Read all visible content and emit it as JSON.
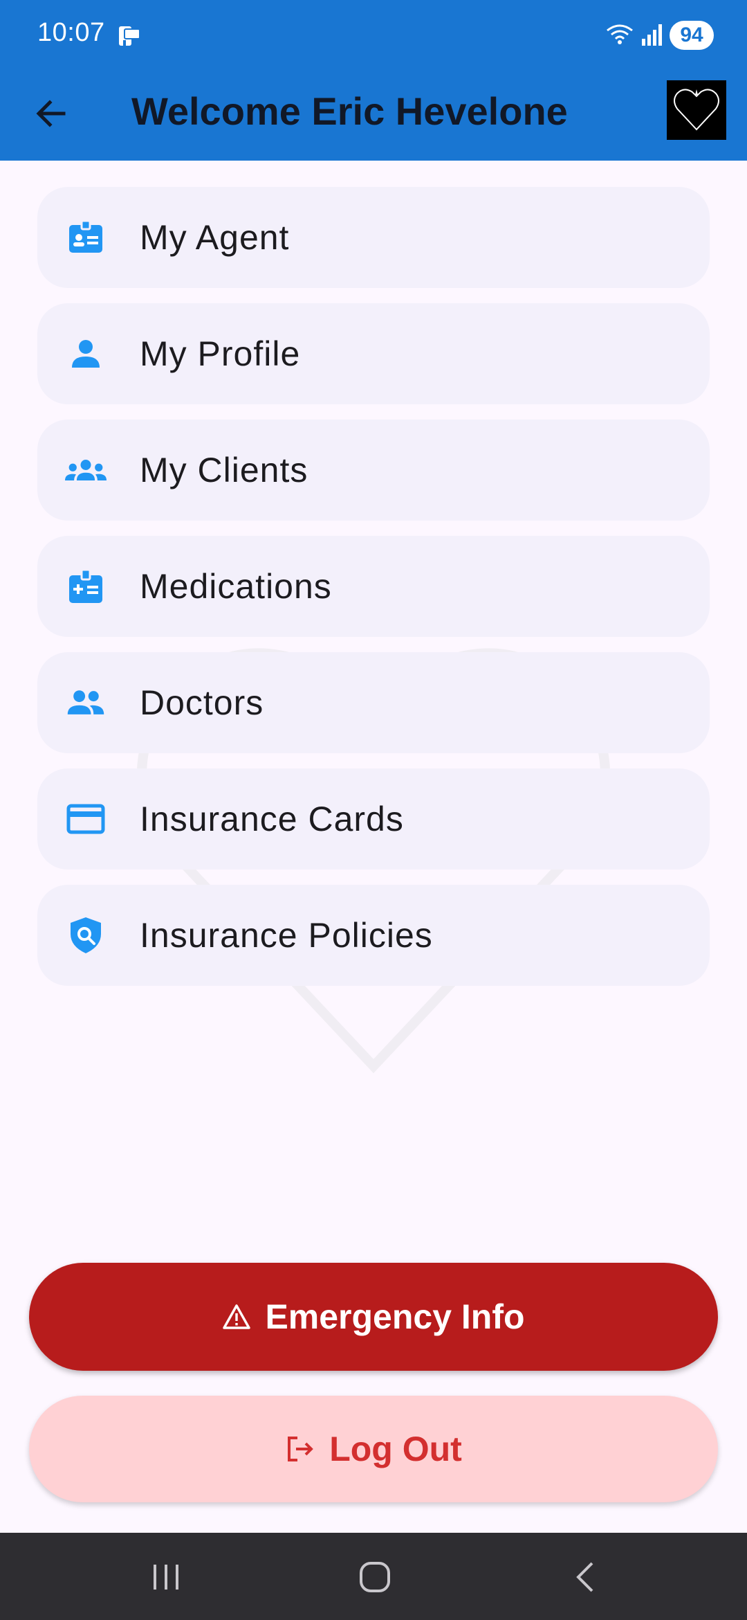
{
  "status_bar": {
    "time": "10:07",
    "battery": "94",
    "icons": [
      "notification-icon",
      "wifi-icon",
      "signal-icon"
    ]
  },
  "app_bar": {
    "title": "Welcome Eric Hevelone",
    "back_icon": "arrow-left-icon",
    "logo_icon": "heart-logo-icon",
    "background": "#1976d2"
  },
  "menu": {
    "items": [
      {
        "label": "My Agent",
        "icon": "badge-icon"
      },
      {
        "label": "My Profile",
        "icon": "person-icon"
      },
      {
        "label": "My Clients",
        "icon": "groups-icon"
      },
      {
        "label": "Medications",
        "icon": "medical-kit-icon"
      },
      {
        "label": "Doctors",
        "icon": "people-icon"
      },
      {
        "label": "Insurance Cards",
        "icon": "credit-card-icon"
      },
      {
        "label": "Insurance Policies",
        "icon": "shield-search-icon"
      }
    ],
    "icon_color": "#2196f3",
    "item_background": "#f3f0fb"
  },
  "actions": {
    "emergency_label": "Emergency Info",
    "emergency_icon": "warning-icon",
    "emergency_color": "#b71c1c",
    "logout_label": "Log Out",
    "logout_icon": "logout-icon",
    "logout_color": "#d32f2f"
  },
  "nav_bar": {
    "buttons": [
      "recents-icon",
      "home-icon",
      "back-icon"
    ]
  }
}
